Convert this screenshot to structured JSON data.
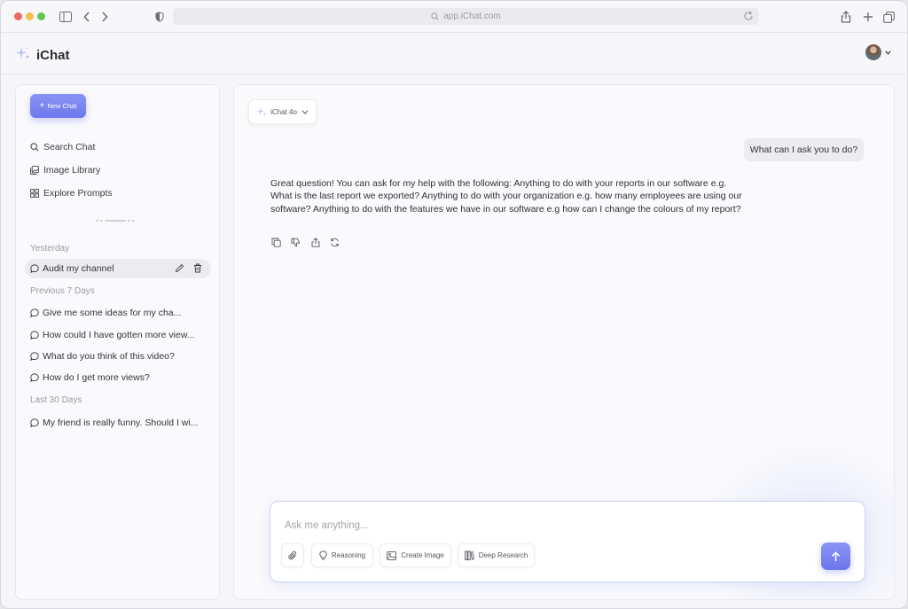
{
  "browser": {
    "url": "app.iChat.com"
  },
  "app": {
    "name": "iChat"
  },
  "sidebar": {
    "new_chat_label": "New Chat",
    "nav": [
      {
        "label": "Search Chat",
        "icon": "search-icon"
      },
      {
        "label": "Image Library",
        "icon": "image-library-icon"
      },
      {
        "label": "Explore Prompts",
        "icon": "grid-icon"
      }
    ],
    "sections": [
      {
        "label": "Yesterday",
        "items": [
          "Audit my channel"
        ]
      },
      {
        "label": "Previous 7 Days",
        "items": [
          "Give me some ideas for my cha...",
          "How could I have gotten more view...",
          "What do you think of this video?",
          "How do I get more views?"
        ]
      },
      {
        "label": "Last 30 Days",
        "items": [
          "My friend is really funny. Should I wi..."
        ]
      }
    ]
  },
  "main": {
    "model_label": "iChat 4o",
    "user_message": "What can I ask you to do?",
    "assistant_message": "Great question! You can ask for my help with the following: Anything to do with your reports in our software e.g. What is the last report we exported? Anything to do with your organization e.g. how many employees are using our software? Anything to do with the features we have in our software e.g how can I change the colours of my report?",
    "composer": {
      "placeholder": "Ask me anything...",
      "tools": [
        "Reasoning",
        "Create Image",
        "Deep Research"
      ]
    }
  },
  "colors": {
    "accent": "#7580f0",
    "background": "#f6f6f8"
  }
}
